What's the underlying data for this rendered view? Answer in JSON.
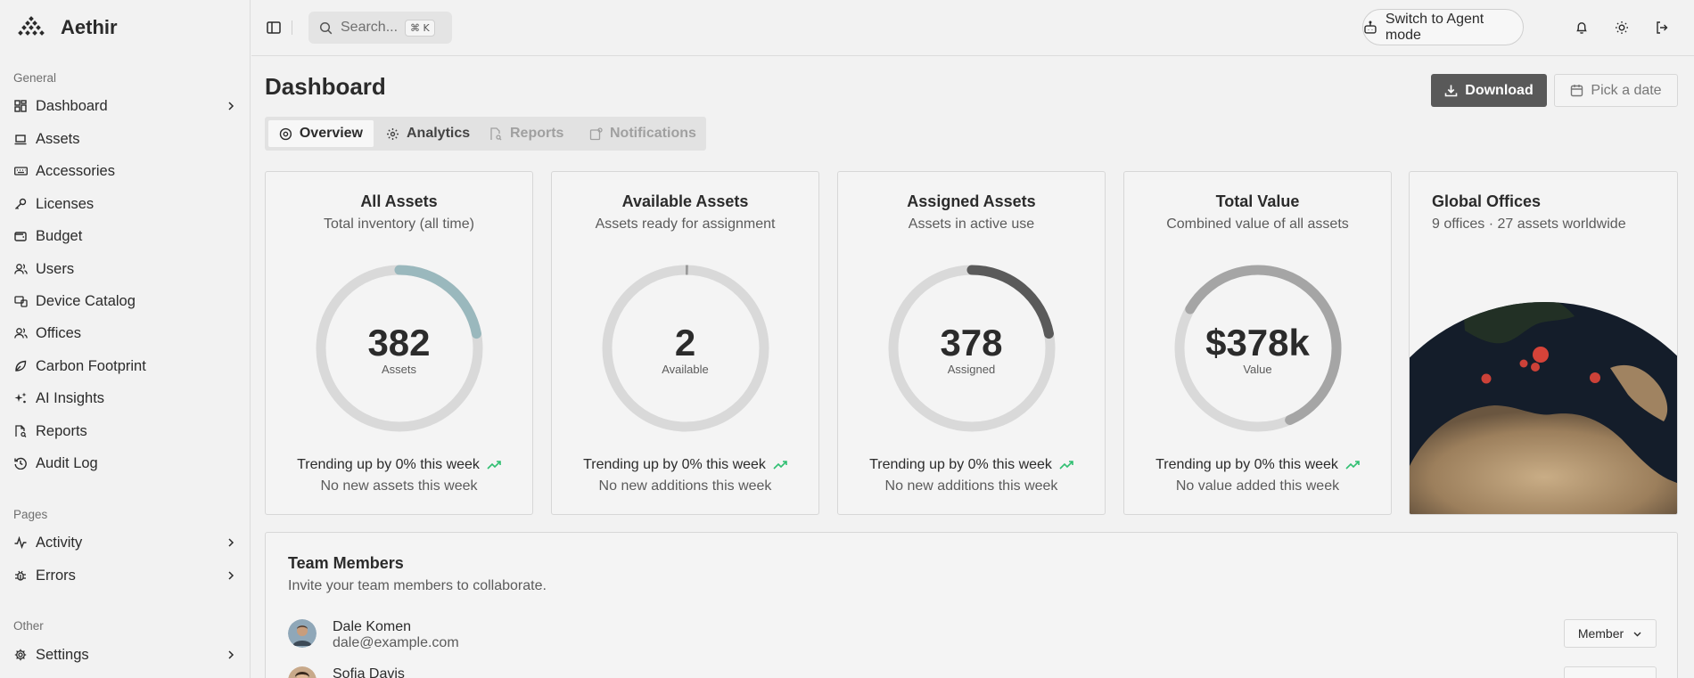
{
  "app": {
    "name": "Aethir"
  },
  "sidebar": {
    "groups": [
      {
        "label": "General"
      },
      {
        "label": "Pages"
      },
      {
        "label": "Other"
      }
    ],
    "items": [
      {
        "label": "Dashboard",
        "icon": "dashboard-icon"
      },
      {
        "label": "Assets",
        "icon": "laptop-icon"
      },
      {
        "label": "Accessories",
        "icon": "keyboard-icon"
      },
      {
        "label": "Licenses",
        "icon": "key-icon"
      },
      {
        "label": "Budget",
        "icon": "wallet-icon"
      },
      {
        "label": "Users",
        "icon": "users-icon"
      },
      {
        "label": "Device Catalog",
        "icon": "device-catalog-icon"
      },
      {
        "label": "Offices",
        "icon": "offices-icon"
      },
      {
        "label": "Carbon Footprint",
        "icon": "leaf-icon"
      },
      {
        "label": "AI Insights",
        "icon": "sparkles-icon"
      },
      {
        "label": "Reports",
        "icon": "reports-icon"
      },
      {
        "label": "Audit Log",
        "icon": "history-icon"
      },
      {
        "label": "Activity",
        "icon": "activity-icon"
      },
      {
        "label": "Errors",
        "icon": "bug-icon"
      },
      {
        "label": "Settings",
        "icon": "gear-icon"
      }
    ]
  },
  "header": {
    "search_placeholder": "Search...",
    "search_shortcut": "⌘ K",
    "agent_mode_label": "Switch to Agent mode"
  },
  "main": {
    "title": "Dashboard",
    "download_label": "Download",
    "date_label": "Pick a date",
    "tabs": [
      {
        "label": "Overview",
        "state": "active"
      },
      {
        "label": "Analytics",
        "state": "enabled"
      },
      {
        "label": "Reports",
        "state": "disabled"
      },
      {
        "label": "Notifications",
        "state": "disabled"
      }
    ]
  },
  "cards": [
    {
      "title": "All Assets",
      "subtitle": "Total inventory (all time)",
      "value": "382",
      "unit": "Assets",
      "trend": "Trending up by 0% this week",
      "footer": "No new assets this week",
      "progress": 0.22,
      "color": "#9ab8bd"
    },
    {
      "title": "Available Assets",
      "subtitle": "Assets ready for assignment",
      "value": "2",
      "unit": "Available",
      "trend": "Trending up by 0% this week",
      "footer": "No new additions this week",
      "progress": 0.005,
      "color": "#9a9a9a"
    },
    {
      "title": "Assigned Assets",
      "subtitle": "Assets in active use",
      "value": "378",
      "unit": "Assigned",
      "trend": "Trending up by 0% this week",
      "footer": "No new additions this week",
      "progress": 0.22,
      "color": "#5a5a5a"
    },
    {
      "title": "Total Value",
      "subtitle": "Combined value of all assets",
      "value": "$378k",
      "unit": "Value",
      "trend": "Trending up by 0% this week",
      "footer": "No value added this week",
      "progress": 0.6,
      "color": "#a5a5a5"
    }
  ],
  "globe": {
    "title": "Global Offices",
    "subtitle": "9 offices · 27 assets worldwide"
  },
  "team": {
    "title": "Team Members",
    "subtitle": "Invite your team members to collaborate.",
    "members": [
      {
        "name": "Dale Komen",
        "email": "dale@example.com",
        "role": "Member"
      },
      {
        "name": "Sofia Davis",
        "email": "",
        "role": ""
      }
    ]
  },
  "colors": {
    "trend_up": "#2fbf71",
    "primary_button": "#595959",
    "office_marker": "#e0463a"
  }
}
